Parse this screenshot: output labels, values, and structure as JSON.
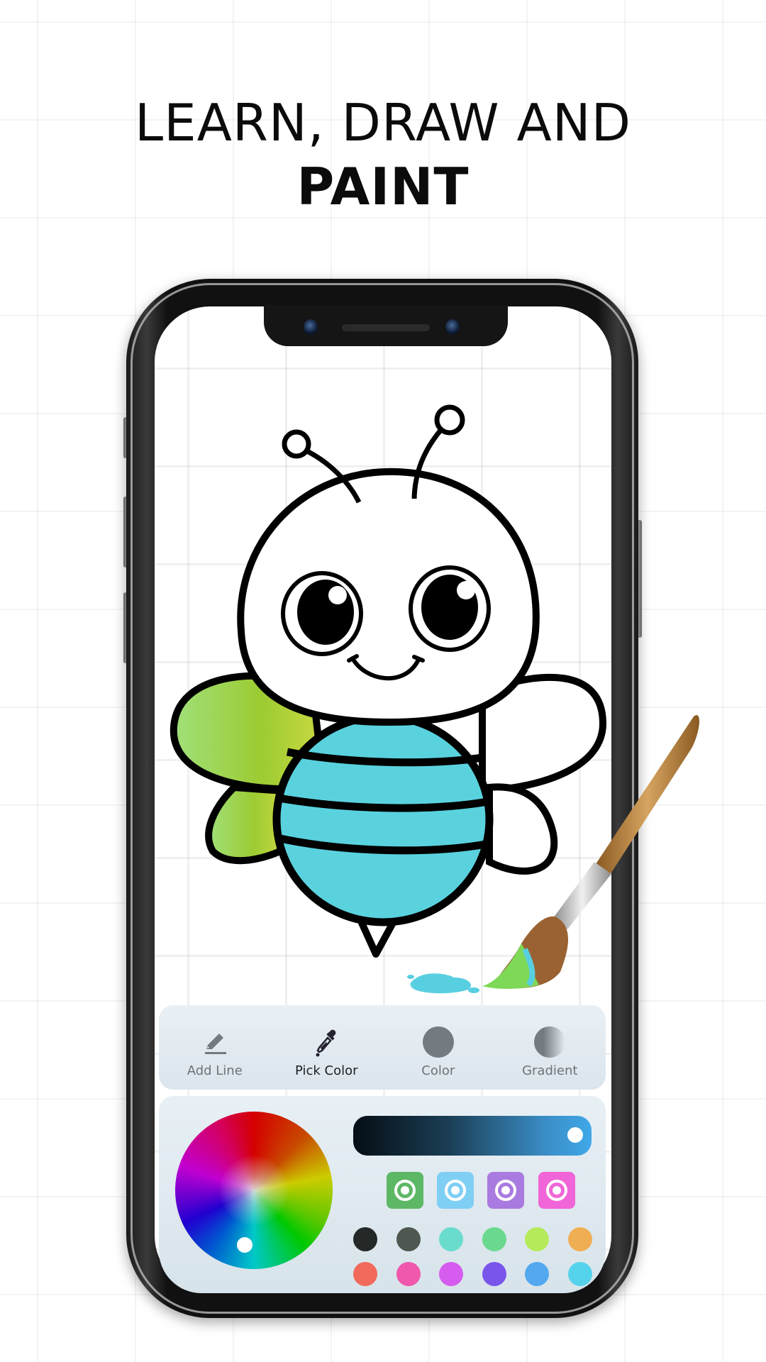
{
  "headline": {
    "line1": "LEARN, DRAW AND",
    "line2": "PAINT"
  },
  "toolbar": {
    "items": [
      {
        "label": "Add Line",
        "icon": "pencil-icon",
        "active": false
      },
      {
        "label": "Pick Color",
        "icon": "eyedropper-icon",
        "active": true
      },
      {
        "label": "Color",
        "icon": "color-dot-icon",
        "active": false,
        "color": "#737b80"
      },
      {
        "label": "Gradient",
        "icon": "gradient-dot-icon",
        "active": false,
        "color": "#737b80"
      }
    ]
  },
  "color_panel": {
    "brightness_value": 1.0,
    "slider_gradient": [
      "#050d14",
      "#40a8e8"
    ],
    "pattern_buttons": [
      {
        "name": "pattern-green",
        "color": "#5db865"
      },
      {
        "name": "pattern-lightblue",
        "color": "#7fcff5"
      },
      {
        "name": "pattern-purple",
        "color": "#a97ae0"
      },
      {
        "name": "pattern-pink",
        "color": "#f065d8"
      }
    ],
    "swatches_row1": [
      "#242826",
      "#4f5751",
      "#6adcce",
      "#6ad98f",
      "#b5ea5b",
      "#f0ae53"
    ],
    "swatches_row2": [
      "#f0695a",
      "#ef58ac",
      "#d55cef",
      "#7a55ec",
      "#53a8f0",
      "#55d3ec"
    ]
  },
  "artwork": {
    "subject": "cartoon bee coloring page",
    "body_color": "#5ad2de",
    "wing_color": "#a8e04a",
    "outline_color": "#000000"
  }
}
